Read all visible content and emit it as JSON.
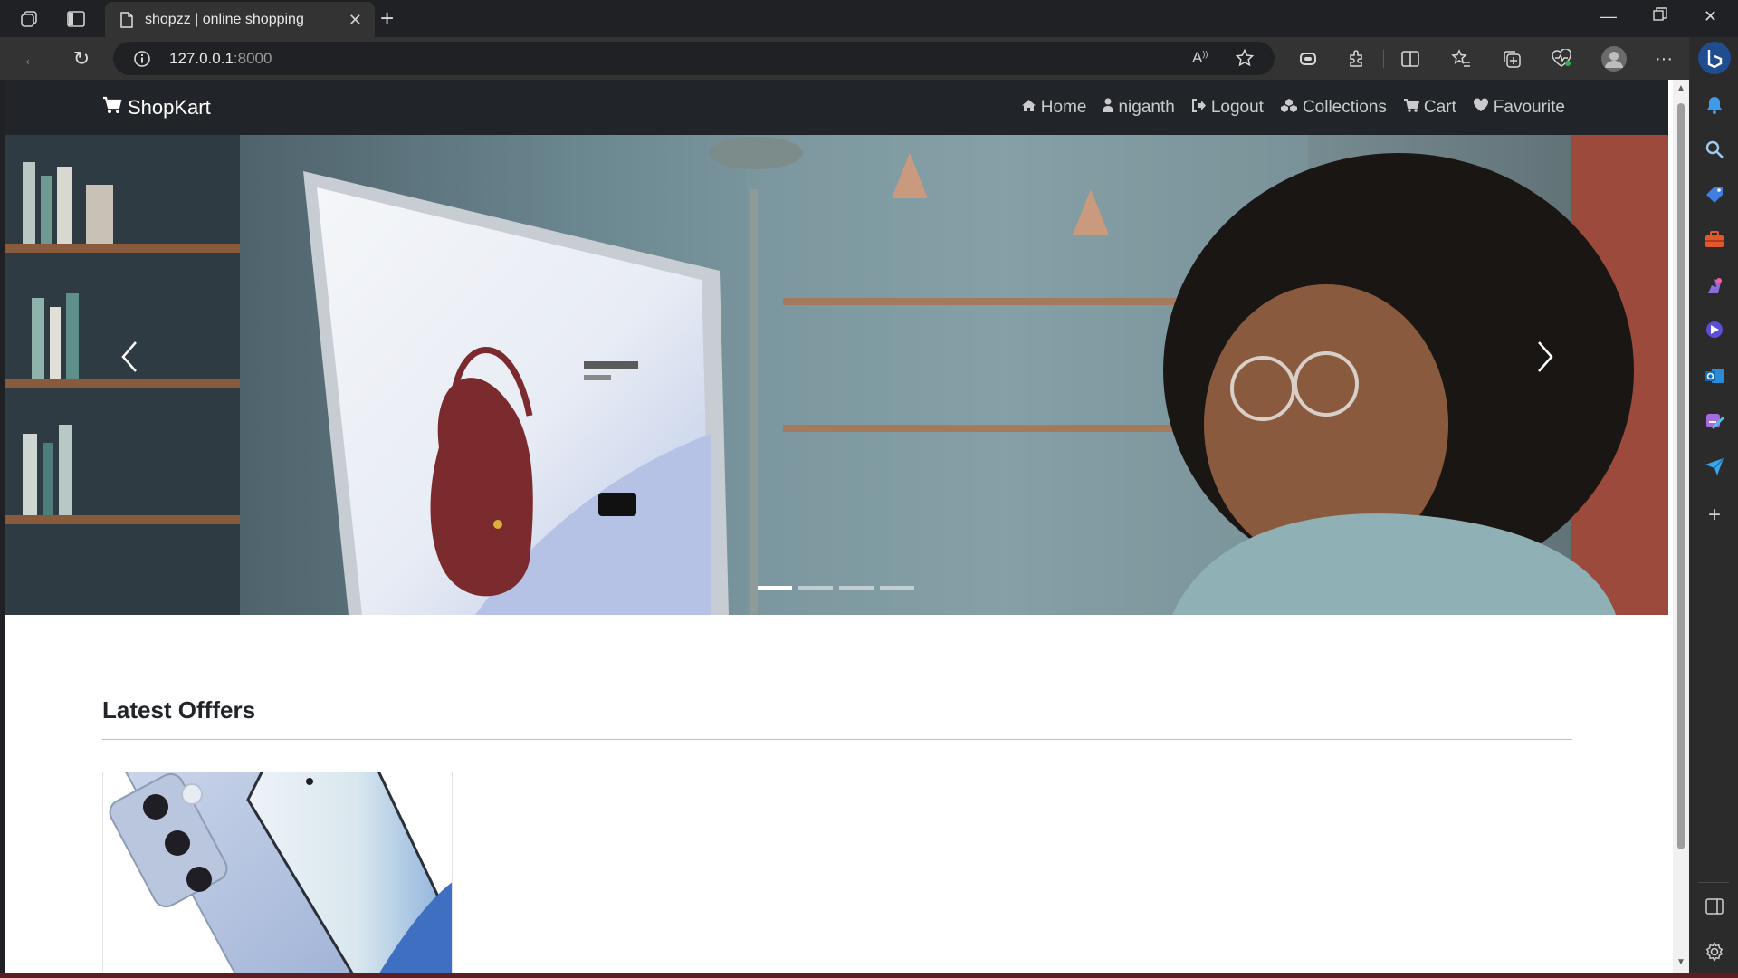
{
  "browser": {
    "tab_title": "shopzz | online shopping",
    "url_host": "127.0.0.1",
    "url_port": ":8000"
  },
  "site": {
    "brand": "ShopKart",
    "menu": [
      {
        "label": "Home",
        "icon": "home-icon"
      },
      {
        "label": "niganth",
        "icon": "user-icon"
      },
      {
        "label": "Logout",
        "icon": "logout-icon"
      },
      {
        "label": "Collections",
        "icon": "collections-icon"
      },
      {
        "label": "Cart",
        "icon": "cart-icon"
      },
      {
        "label": "Favourite",
        "icon": "heart-icon"
      }
    ]
  },
  "carousel": {
    "slide_count": 4,
    "active_index": 0
  },
  "offers": {
    "heading": "Latest Offfers"
  },
  "colors": {
    "navbar_bg": "#212529",
    "browser_bg": "#202124",
    "toolbar_bg": "#333333"
  }
}
